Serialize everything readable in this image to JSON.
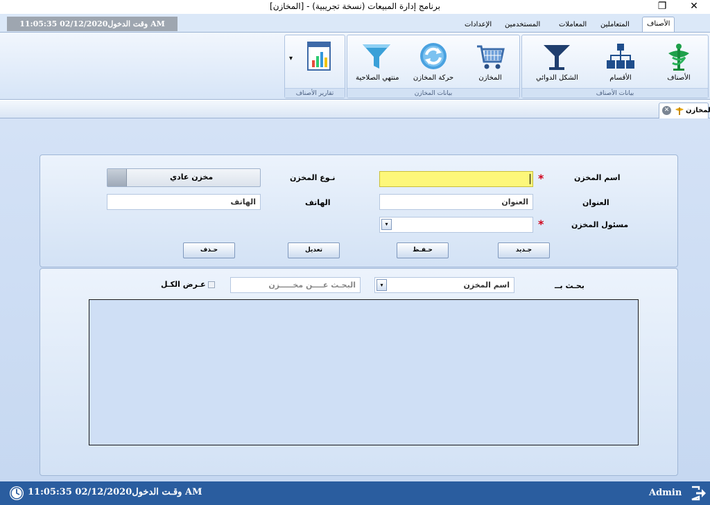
{
  "window": {
    "title": "برنامج إدارة المبيعات (نسخة تجريبية) - [المخازن]",
    "close_glyph": "✕",
    "restore_glyph": "❐"
  },
  "header": {
    "login_time": "وقت الدخول02/12/2020 11:05:35 AM"
  },
  "tabs": [
    {
      "label": "الأصناف",
      "active": true
    },
    {
      "label": "المتعاملين"
    },
    {
      "label": "المعاملات"
    },
    {
      "label": "المستخدمين"
    },
    {
      "label": "الإعدادات"
    }
  ],
  "ribbon": {
    "groups": {
      "items_data": "بيانات الأصناف",
      "stores_data": "بيانات المخازن",
      "reports": "تقارير الأصناف"
    },
    "buttons": {
      "items": "الأصناف",
      "sections": "الأقسام",
      "dosage_form": "الشكل الدوائي",
      "stores": "المخازن",
      "store_movement": "حركة المخازن",
      "expiry": "منتهي الصلاحية"
    },
    "dropdown_glyph": "▾"
  },
  "doc_tab": {
    "label": "المخازن"
  },
  "form": {
    "store_name_label": "اسم المخزن",
    "store_name_value": "",
    "store_type_label": "نـوع المخزن",
    "store_type_value": "مخزن عادي",
    "address_label": "العنوان",
    "address_placeholder": "العنوان",
    "phone_label": "الهاتف",
    "phone_placeholder": "الهاتف",
    "manager_label": "مسئول المخزن",
    "manager_value": "",
    "required_mark": "*",
    "buttons": {
      "new": "جـديد",
      "save": "حـفـظ",
      "edit": "تعديل",
      "delete": "حـذف"
    }
  },
  "search": {
    "search_by_label": "بحـث بــ",
    "search_by_value": "اسم المخزن",
    "search_placeholder": "البحـث عــــن مخـــــزن",
    "show_all_label": "عـرض الكـل"
  },
  "statusbar": {
    "login_time": "وقـت الدخول02/12/2020 11:05:35 AM",
    "user": "Admin"
  },
  "colors": {
    "highlight_input": "#fdf77a",
    "status_bar": "#2a5d9f"
  }
}
